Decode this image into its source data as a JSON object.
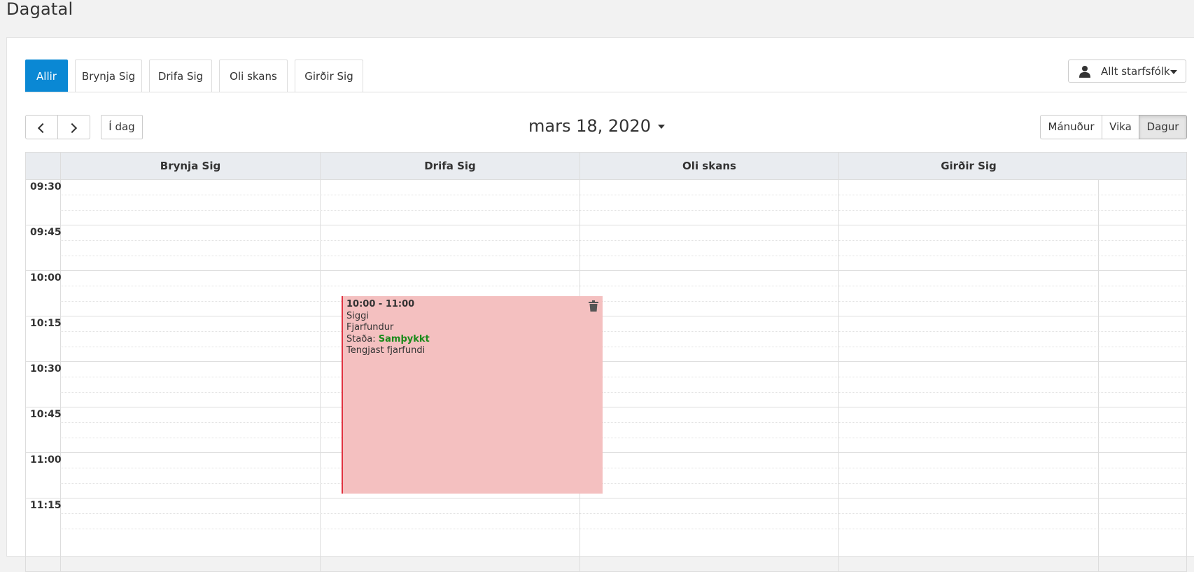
{
  "page": {
    "title": "Dagatal"
  },
  "tabs": [
    {
      "label": "Allir",
      "active": true
    },
    {
      "label": "Brynja Sig"
    },
    {
      "label": "Drifa Sig"
    },
    {
      "label": "Oli skans"
    },
    {
      "label": "Girðir Sig"
    }
  ],
  "staff_dropdown": {
    "label": "Allt starfsfólk",
    "icon": "user-icon"
  },
  "toolbar": {
    "today_label": "Í dag",
    "date_title": "mars 18, 2020",
    "views": [
      "Mánuður",
      "Vika",
      "Dagur"
    ],
    "active_view": "Dagur"
  },
  "calendar": {
    "columns": [
      "Brynja Sig",
      "Drifa Sig",
      "Oli skans",
      "Girðir Sig"
    ],
    "times": [
      "09:30",
      "09:45",
      "10:00",
      "10:15",
      "10:30",
      "10:45",
      "11:00",
      "11:15"
    ],
    "event": {
      "column": "Drifa Sig",
      "time": "10:00 - 11:00",
      "name": "Siggi",
      "type": "Fjarfundur",
      "status_label": "Staða:",
      "status_value": "Samþykkt",
      "note": "Tengjast fjarfundi",
      "color": "#f4c0c0",
      "accent": "#e0313f"
    }
  }
}
